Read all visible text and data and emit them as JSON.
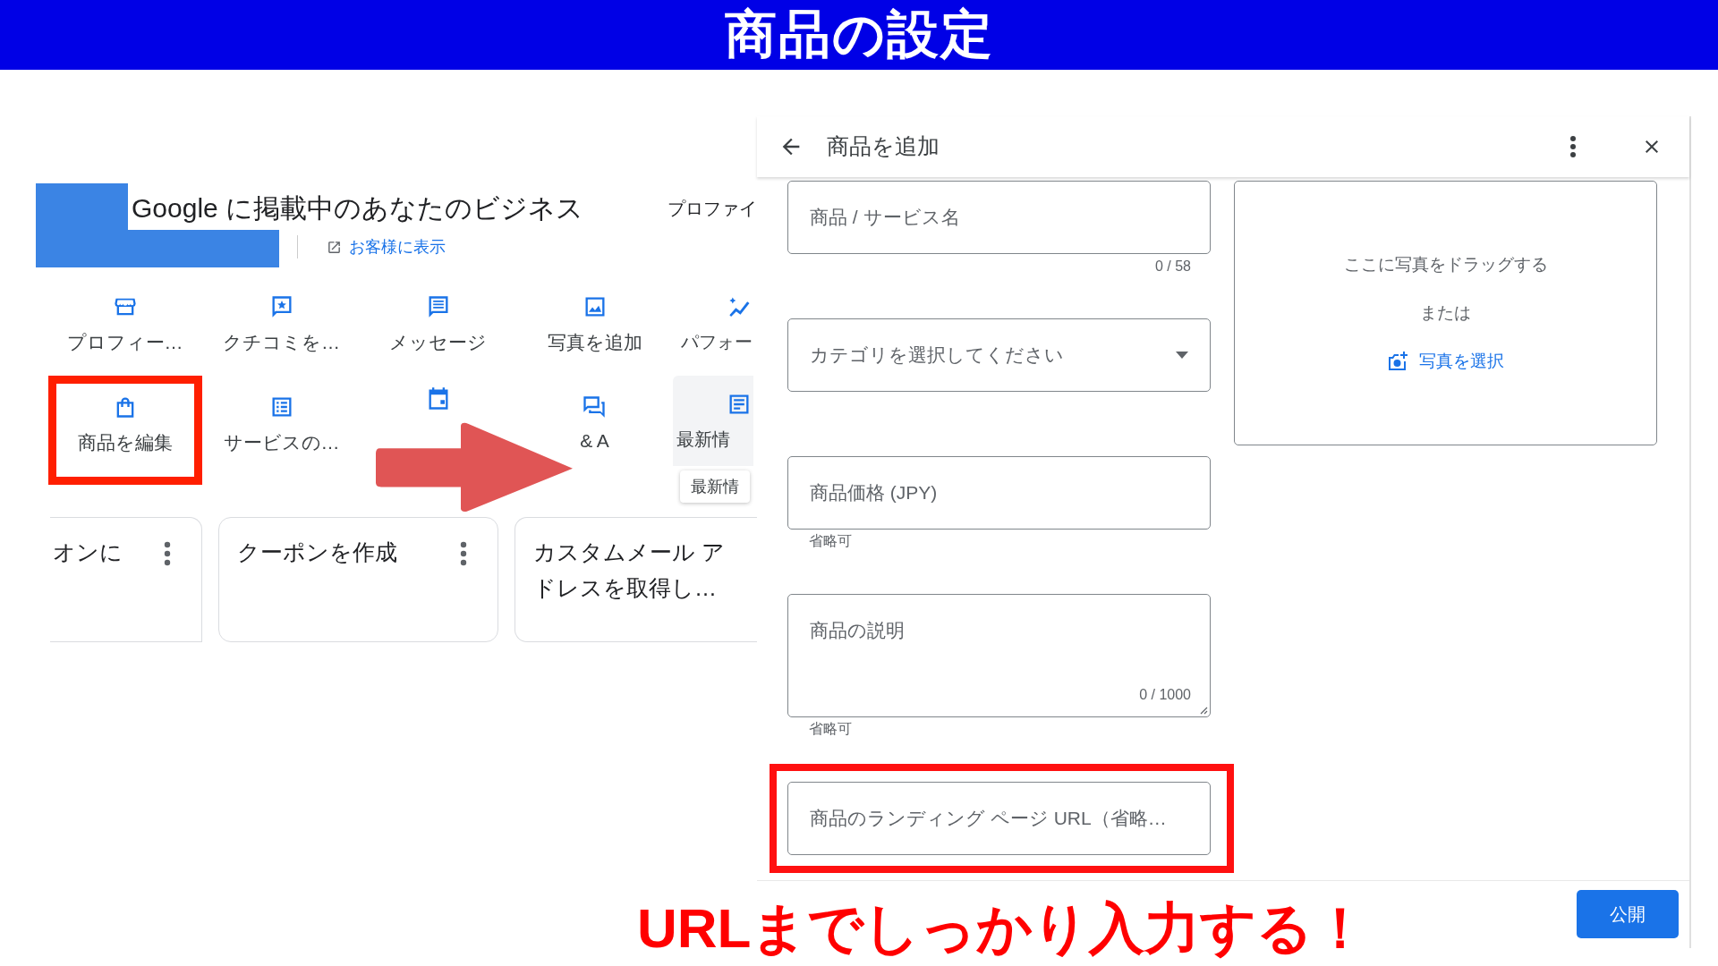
{
  "banner": {
    "title": "商品の設定"
  },
  "business_panel": {
    "title": "Google に掲載中のあなたのビジネス",
    "header_tab": "プロファイ",
    "view_link": "お客様に表示",
    "action_rows": [
      [
        {
          "kind": "store",
          "label": "プロフィー…",
          "highlighted": false
        },
        {
          "kind": "review",
          "label": "クチコミを…",
          "highlighted": false
        },
        {
          "kind": "message",
          "label": "メッセージ",
          "highlighted": false
        },
        {
          "kind": "photo",
          "label": "写真を追加",
          "highlighted": false
        },
        {
          "kind": "performance",
          "label": "パフォー",
          "highlighted": false
        }
      ],
      [
        {
          "kind": "bag",
          "label": "商品を編集",
          "highlighted": true
        },
        {
          "kind": "list",
          "label": "サービスの…",
          "highlighted": false
        },
        {
          "kind": "calendar",
          "highlighted": false
        },
        {
          "kind": "qa",
          "label": "& A",
          "highlighted": false
        },
        {
          "kind": "post",
          "label": "最新情",
          "tooltip": "最新情",
          "highlighted": false
        }
      ]
    ],
    "cards": [
      {
        "title": "オンに",
        "menu": true
      },
      {
        "title": "クーポンを作成",
        "menu": true
      },
      {
        "title": "カスタムメール アドレスを取得し…",
        "menu": false
      }
    ]
  },
  "product_dialog": {
    "title": "商品を追加",
    "fields": [
      {
        "kind": "text",
        "placeholder": "商品 / サービス名",
        "counter": "0 / 58",
        "highlighted": false
      },
      {
        "kind": "select",
        "placeholder": "カテゴリを選択してください",
        "highlighted": false
      },
      {
        "kind": "text",
        "placeholder": "商品価格 (JPY)",
        "helper": "省略可",
        "highlighted": false
      },
      {
        "kind": "textarea",
        "placeholder": "商品の説明",
        "counter": "0 / 1000",
        "helper": "省略可",
        "highlighted": false
      },
      {
        "kind": "text",
        "placeholder": "商品のランディング ページ URL（省略…",
        "highlighted": true
      }
    ],
    "photo": {
      "drag_text": "ここに写真をドラッグする",
      "or_text": "または",
      "select_link": "写真を選択"
    },
    "publish_button": "公開"
  },
  "caption": "URLまでしっかり入力する！"
}
